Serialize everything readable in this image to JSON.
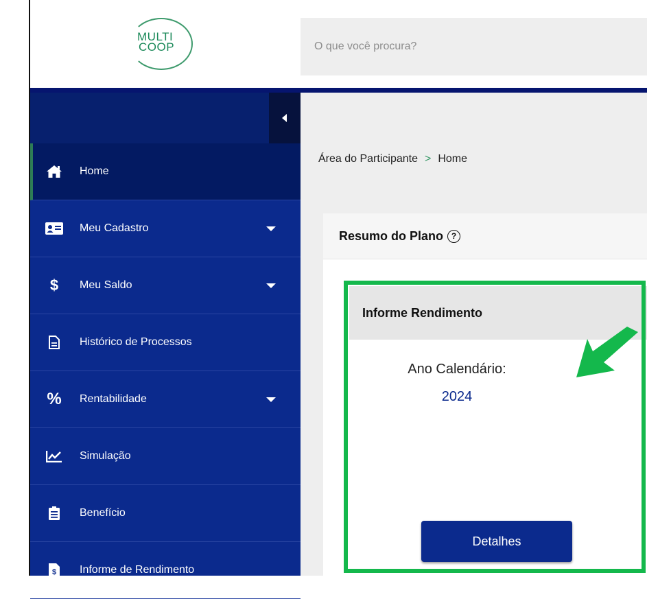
{
  "header": {
    "logo": {
      "line1": "MULTI",
      "line2": "COOP"
    },
    "search": {
      "placeholder": "O que você procura?"
    }
  },
  "sidebar": {
    "items": [
      {
        "label": "Home",
        "icon": "home-icon",
        "active": true
      },
      {
        "label": "Meu Cadastro",
        "icon": "id-card-icon",
        "has_dropdown": true
      },
      {
        "label": "Meu Saldo",
        "icon": "dollar-icon",
        "has_dropdown": true
      },
      {
        "label": "Histórico de Processos",
        "icon": "document-icon"
      },
      {
        "label": "Rentabilidade",
        "icon": "percent-icon",
        "has_dropdown": true
      },
      {
        "label": "Simulação",
        "icon": "chart-line-icon"
      },
      {
        "label": "Benefício",
        "icon": "clipboard-icon"
      },
      {
        "label": "Informe de Rendimento",
        "icon": "invoice-icon"
      }
    ]
  },
  "breadcrumb": {
    "root": "Área do Participante",
    "separator": ">",
    "current": "Home"
  },
  "summary_card": {
    "title": "Resumo do Plano",
    "help_symbol": "?",
    "informe": {
      "title": "Informe Rendimento",
      "year_label": "Ano Calendário:",
      "year_value": "2024",
      "button_label": "Detalhes"
    }
  },
  "colors": {
    "sidebar_bg": "#0b2a8d",
    "sidebar_active": "#031a62",
    "highlight": "#14b84c",
    "accent_green": "#3b9a6a",
    "button_bg": "#0b2a8d"
  }
}
